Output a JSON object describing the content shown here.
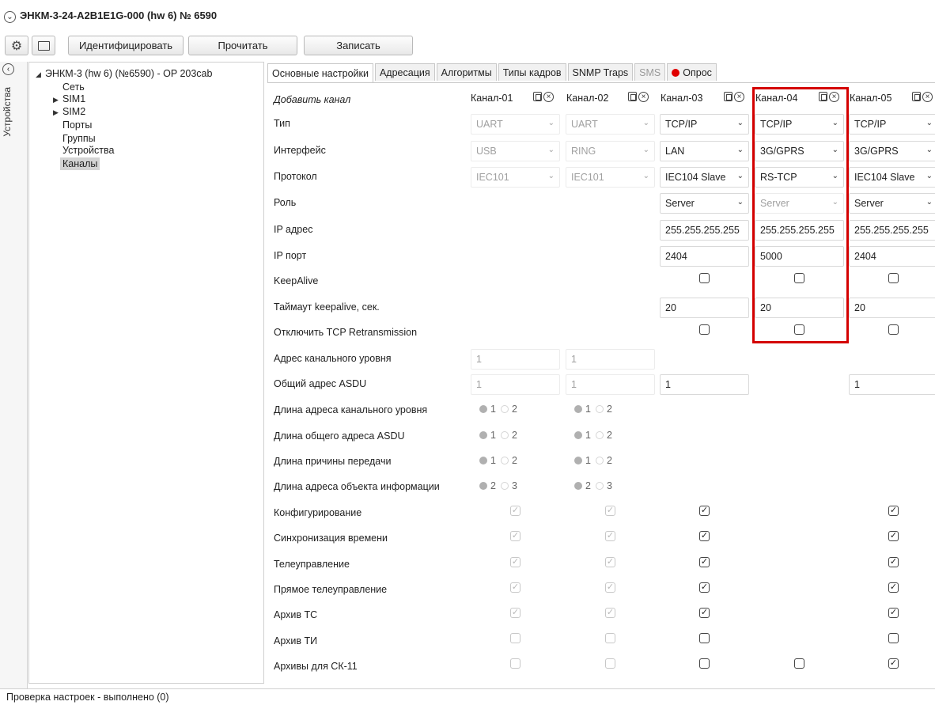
{
  "window": {
    "title": "ЭНКМ-3-24-A2B1E1G-000 (hw 6) № 6590"
  },
  "toolbar": {
    "identify": "Идентифицировать",
    "read": "Прочитать",
    "write": "Записать"
  },
  "side": {
    "label": "Устройства"
  },
  "tree": {
    "root": "ЭНКМ-3 (hw 6) (№6590) - OP 203cab",
    "items": [
      "Сеть",
      "SIM1",
      "SIM2",
      "Порты",
      "Группы",
      "Устройства",
      "Каналы"
    ],
    "selected": "Каналы"
  },
  "tabs": [
    "Основные настройки",
    "Адресация",
    "Алгоритмы",
    "Типы кадров",
    "SNMP Traps",
    "SMS",
    "Опрос"
  ],
  "labels": {
    "add_channel": "Добавить канал",
    "rows": [
      "Тип",
      "Интерфейс",
      "Протокол",
      "Роль",
      "IP адрес",
      "IP порт",
      "KeepAlive",
      "Таймаут keepalive, сек.",
      "Отключить TCP Retransmission",
      "Адрес канального уровня",
      "Общий адрес ASDU",
      "Длина адреса канального уровня",
      "Длина общего адреса ASDU",
      "Длина причины передачи",
      "Длина адреса объекта информации",
      "Конфигурирование",
      "Синхронизация времени",
      "Телеуправление",
      "Прямое телеуправление",
      "Архив ТС",
      "Архив ТИ",
      "Архивы для СК-11"
    ]
  },
  "channels": [
    {
      "name": "Канал-01",
      "type": "UART",
      "interface": "USB",
      "protocol": "IEC101",
      "link_addr": "1",
      "asdu": "1",
      "radios": [
        [
          "1",
          "2"
        ],
        [
          "1",
          "2"
        ],
        [
          "1",
          "2"
        ],
        [
          "2",
          "3"
        ]
      ]
    },
    {
      "name": "Канал-02",
      "type": "UART",
      "interface": "RING",
      "protocol": "IEC101",
      "link_addr": "1",
      "asdu": "1",
      "radios": [
        [
          "1",
          "2"
        ],
        [
          "1",
          "2"
        ],
        [
          "1",
          "2"
        ],
        [
          "2",
          "3"
        ]
      ]
    },
    {
      "name": "Канал-03",
      "type": "TCP/IP",
      "interface": "LAN",
      "protocol": "IEC104 Slave",
      "role": "Server",
      "ip": "255.255.255.255",
      "port": "2404",
      "timeout": "20",
      "asdu": "1"
    },
    {
      "name": "Канал-04",
      "type": "TCP/IP",
      "interface": "3G/GPRS",
      "protocol": "RS-TCP",
      "role": "Server",
      "ip": "255.255.255.255",
      "port": "5000",
      "timeout": "20"
    },
    {
      "name": "Канал-05",
      "type": "TCP/IP",
      "interface": "3G/GPRS",
      "protocol": "IEC104 Slave",
      "role": "Server",
      "ip": "255.255.255.255",
      "port": "2404",
      "timeout": "20",
      "asdu": "1"
    }
  ],
  "status": {
    "text": "Проверка настроек - выполнено (0)"
  },
  "colors": {
    "highlight": "#d40000",
    "record": "#e00000"
  }
}
